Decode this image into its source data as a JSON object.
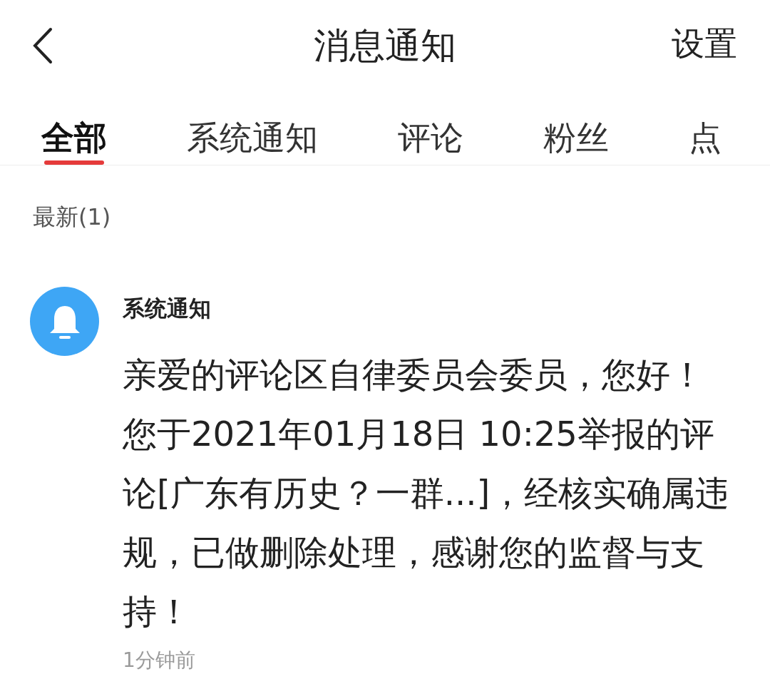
{
  "header": {
    "title": "消息通知",
    "settings": "设置"
  },
  "tabs": [
    {
      "label": "全部",
      "selected": true
    },
    {
      "label": "系统通知",
      "selected": false
    },
    {
      "label": "评论",
      "selected": false
    },
    {
      "label": "粉丝",
      "selected": false
    },
    {
      "label": "点",
      "selected": false
    }
  ],
  "section_title": "最新(1)",
  "notifications": [
    {
      "sender": "系统通知",
      "message": "亲爱的评论区自律委员会委员，您好！您于2021年01月18日 10:25举报的评论[广东有历史？一群...]，经核实确属违规，已做删除处理，感谢您的监督与支持！",
      "time": "1分钟前"
    }
  ]
}
